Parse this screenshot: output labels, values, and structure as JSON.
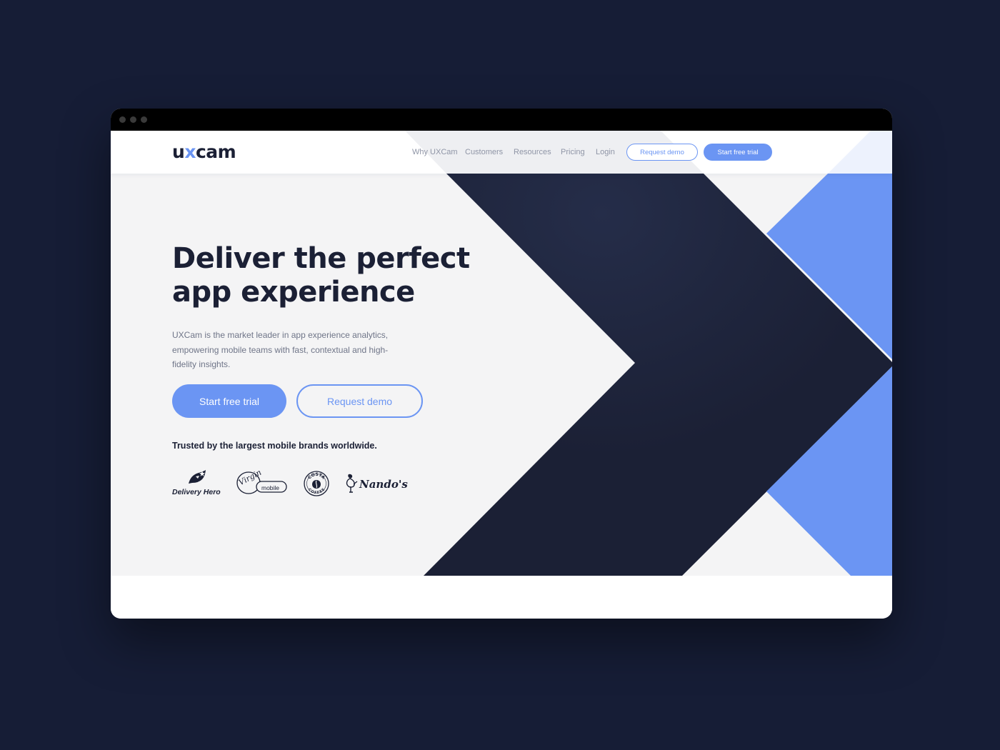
{
  "colors": {
    "page_background": "#161d36",
    "brand_blue": "#6b95f3",
    "dark_navy": "#1b2035",
    "hero_background": "#f4f4f5"
  },
  "logo": {
    "prefix": "u",
    "x": "x",
    "suffix": "cam"
  },
  "nav": {
    "links": [
      "Why UXCam",
      "Customers",
      "Resources",
      "Pricing",
      "Login"
    ],
    "request_demo": "Request demo",
    "start_trial": "Start free trial"
  },
  "hero": {
    "headline_line1": "Deliver the perfect",
    "headline_line2": "app experience",
    "subtext": "UXCam is the market leader in app experience analytics, empowering mobile teams with fast, contextual and high-fidelity insights.",
    "cta_primary": "Start free trial",
    "cta_secondary": "Request demo",
    "trusted": "Trusted by the largest mobile brands worldwide."
  },
  "brands": {
    "delivery_hero": "Delivery Hero",
    "virgin": "Virgin",
    "mobile": "mobile",
    "costa": "COSTA",
    "coffee": "COFFEE",
    "nandos": "Nando's"
  }
}
